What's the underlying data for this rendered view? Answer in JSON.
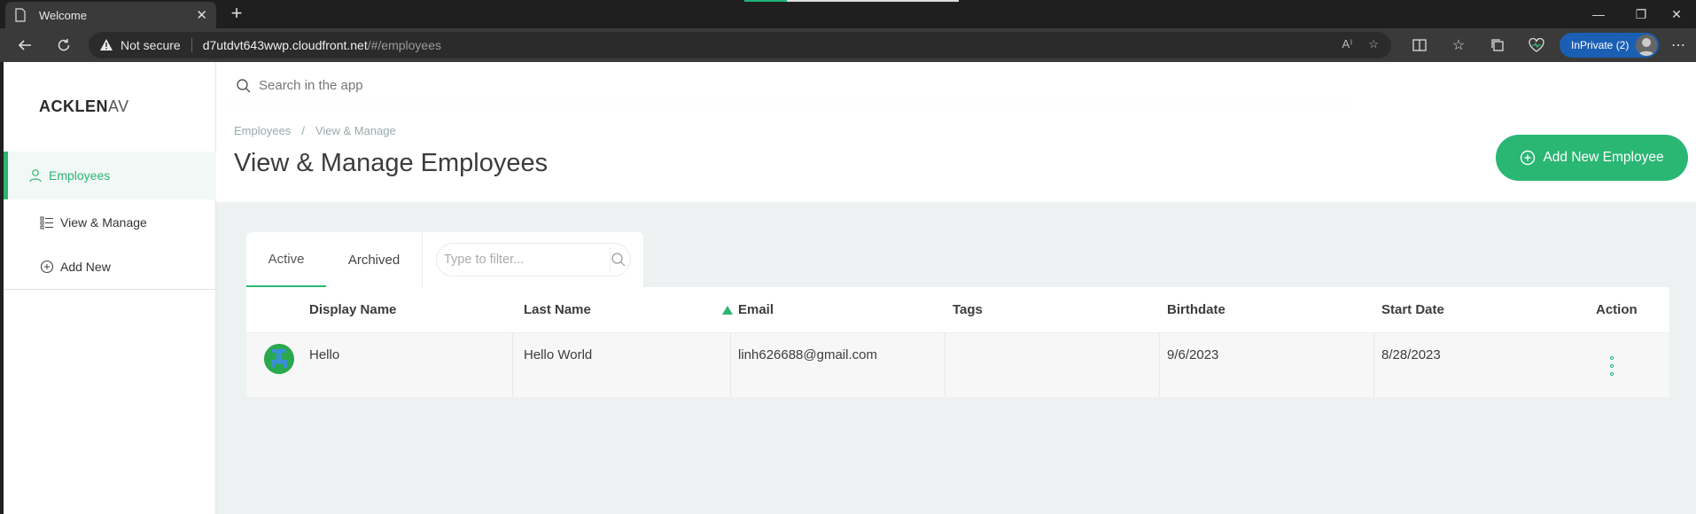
{
  "browser": {
    "tab_title": "Welcome",
    "security_label": "Not secure",
    "url_host": "d7utdvt643wwp.cloudfront.net",
    "url_path": "/#/employees",
    "profile_label": "InPrivate (2)"
  },
  "app": {
    "logo_bold": "ACKLEN",
    "logo_light": "AV",
    "search_placeholder": "Search in the app",
    "sidebar": {
      "items": [
        {
          "label": "Employees",
          "icon": "user-icon"
        },
        {
          "label": "View & Manage",
          "icon": "list-icon"
        },
        {
          "label": "Add New",
          "icon": "plus-circle-icon"
        }
      ]
    },
    "breadcrumb": [
      "Employees",
      "/",
      "View & Manage"
    ],
    "page_title": "View & Manage Employees",
    "add_button_label": "Add New Employee",
    "tabs": [
      {
        "label": "Active",
        "active": true
      },
      {
        "label": "Archived",
        "active": false
      }
    ],
    "filter_placeholder": "Type to filter...",
    "table": {
      "columns": [
        "Display Name",
        "Last Name",
        "Email",
        "Tags",
        "Birthdate",
        "Start Date",
        "Action"
      ],
      "sorted_column": "Email",
      "rows": [
        {
          "display_name": "Hello",
          "last_name": "Hello World",
          "email": "linh626688@gmail.com",
          "tags": "",
          "birthdate": "9/6/2023",
          "start_date": "8/28/2023"
        }
      ]
    },
    "colors": {
      "accent": "#2ab673",
      "content_bg": "#eef1f1"
    }
  }
}
